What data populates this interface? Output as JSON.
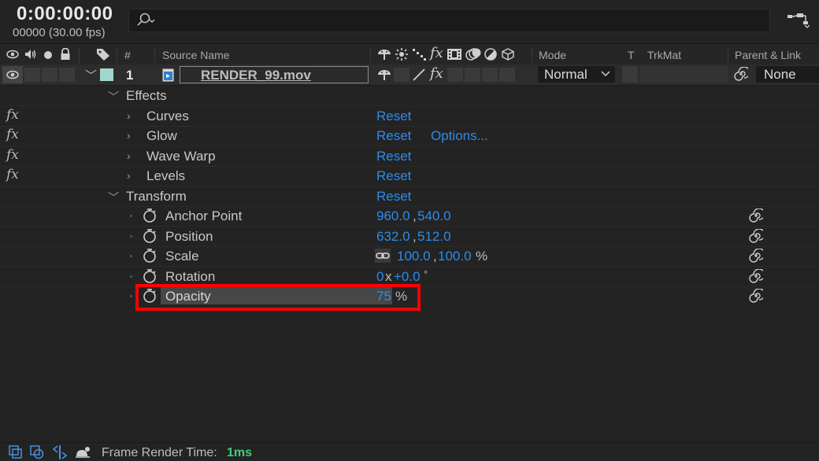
{
  "topbar": {
    "timecode": "0:00:00:00",
    "frame_info": "00000 (30.00 fps)",
    "search_placeholder": ""
  },
  "columns": {
    "hash": "#",
    "source_name": "Source Name",
    "mode": "Mode",
    "t": "T",
    "trkmat": "TrkMat",
    "parent_link": "Parent & Link"
  },
  "layer": {
    "number": "1",
    "name": "RENDER_99.mov",
    "mode": "Normal",
    "parent": "None"
  },
  "effects": {
    "label": "Effects",
    "items": [
      {
        "name": "Curves",
        "reset": "Reset"
      },
      {
        "name": "Glow",
        "reset": "Reset",
        "options": "Options..."
      },
      {
        "name": "Wave Warp",
        "reset": "Reset"
      },
      {
        "name": "Levels",
        "reset": "Reset"
      }
    ]
  },
  "transform": {
    "label": "Transform",
    "reset": "Reset",
    "anchor_point": {
      "label": "Anchor Point",
      "x": "960.0",
      "y": "540.0"
    },
    "position": {
      "label": "Position",
      "x": "632.0",
      "y": "512.0"
    },
    "scale": {
      "label": "Scale",
      "x": "100.0",
      "y": "100.0",
      "unit": "%"
    },
    "rotation": {
      "label": "Rotation",
      "revolutions": "0",
      "x_sep": "x",
      "degrees": "+0.0",
      "unit": "°"
    },
    "opacity": {
      "label": "Opacity",
      "value": "75",
      "unit": "%"
    }
  },
  "fx_marker": "fx",
  "status": {
    "render_label": "Frame Render Time:",
    "render_value": "1ms"
  },
  "colors": {
    "accent_blue": "#2d8ceb",
    "highlight_red": "#ff0000",
    "render_green": "#3fd07a",
    "label_color": "#a3d6cf"
  }
}
